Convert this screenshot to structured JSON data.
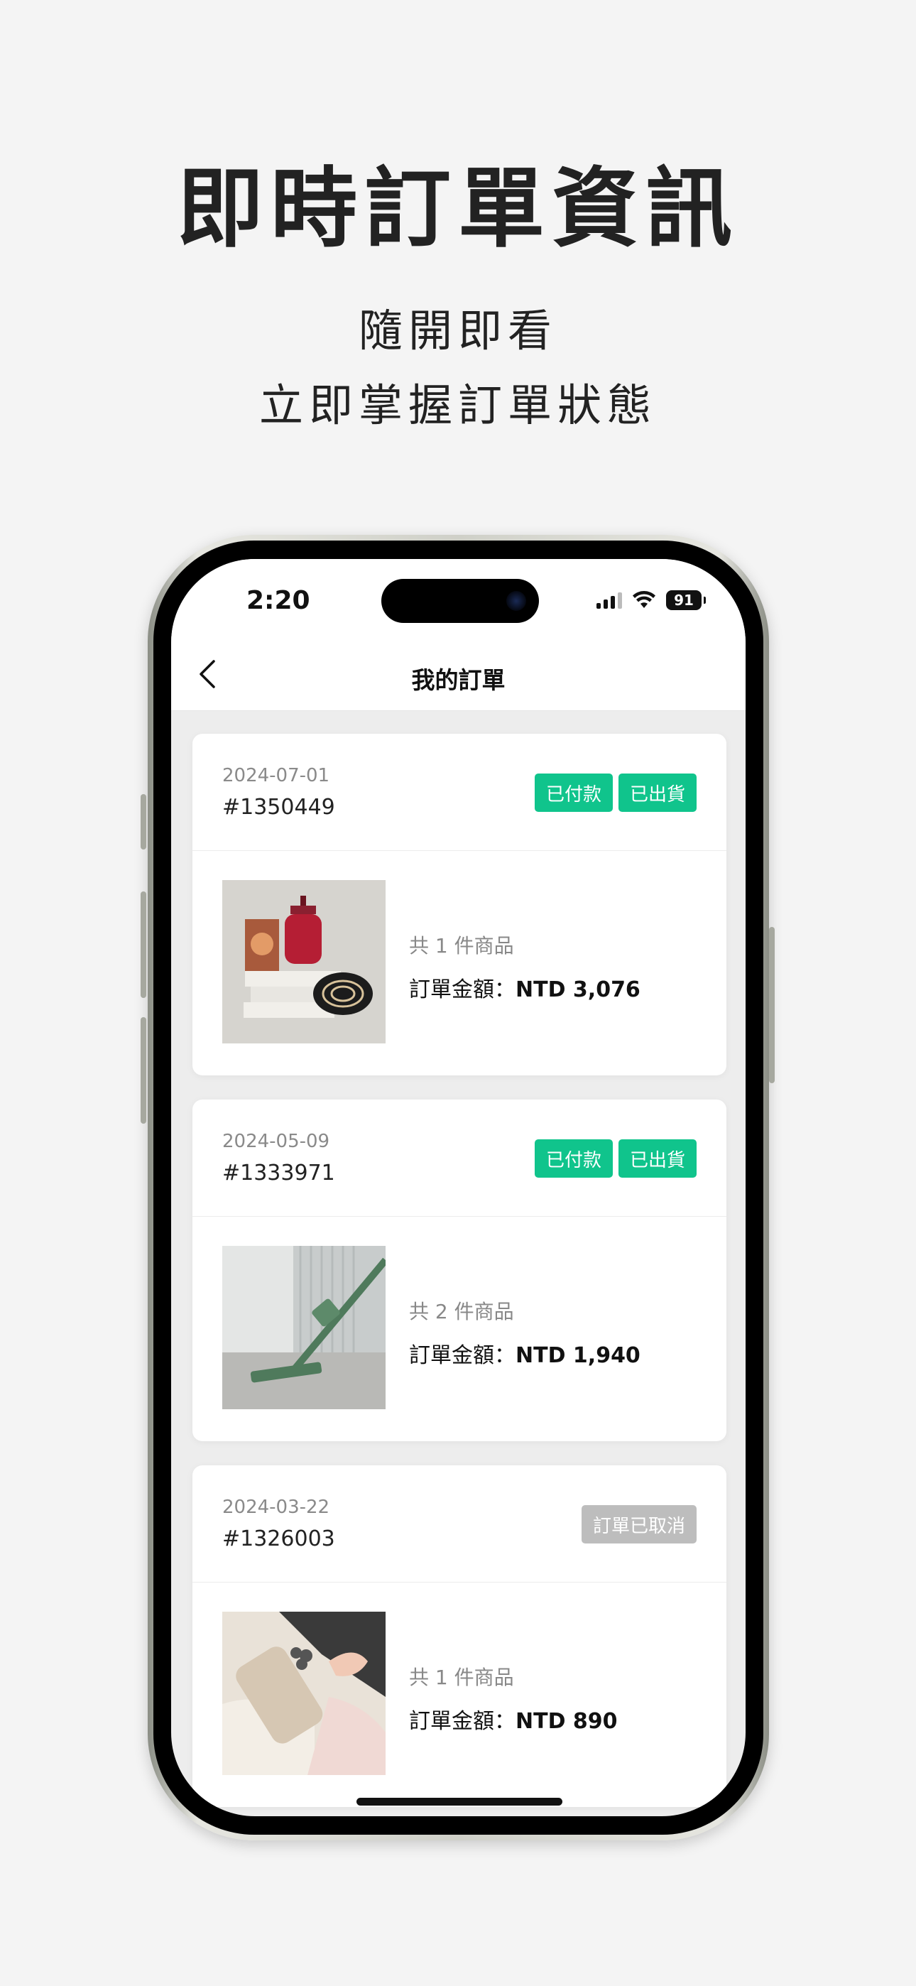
{
  "promo": {
    "headline": "即時訂單資訊",
    "subline_1": "隨開即看",
    "subline_2": "立即掌握訂單狀態"
  },
  "status_bar": {
    "time": "2:20",
    "battery": "91"
  },
  "nav": {
    "title": "我的訂單"
  },
  "orders": [
    {
      "date": "2024-07-01",
      "number": "#1350449",
      "badges": [
        "已付款",
        "已出貨"
      ],
      "item_count": "共 1 件商品",
      "amount_label": "訂單金額：",
      "amount": "NTD 3,076"
    },
    {
      "date": "2024-05-09",
      "number": "#1333971",
      "badges": [
        "已付款",
        "已出貨"
      ],
      "item_count": "共 2 件商品",
      "amount_label": "訂單金額：",
      "amount": "NTD 1,940"
    },
    {
      "date": "2024-03-22",
      "number": "#1326003",
      "badges": [
        "訂單已取消"
      ],
      "item_count": "共 1 件商品",
      "amount_label": "訂單金額：",
      "amount": "NTD 890"
    }
  ],
  "colors": {
    "badge_green": "#10c48c",
    "badge_grey": "#bdbdbd",
    "background": "#f4f4f4"
  }
}
